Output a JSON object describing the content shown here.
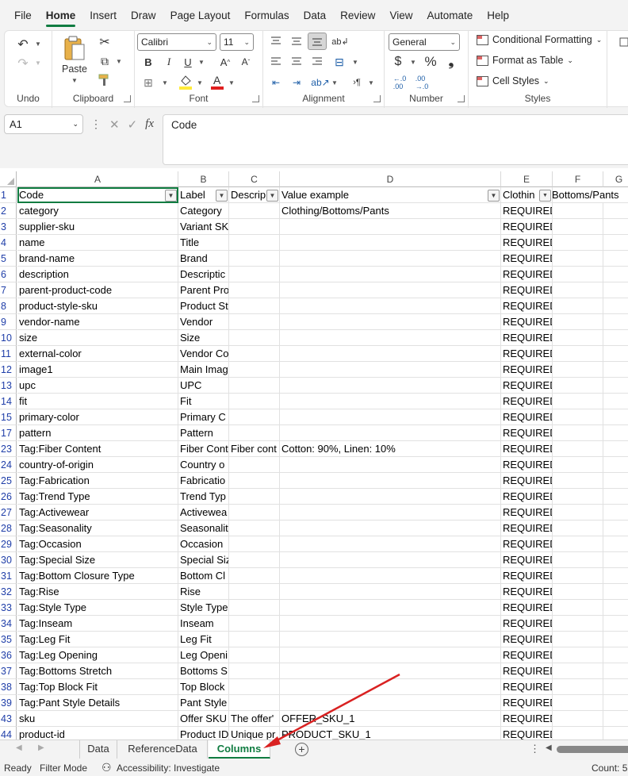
{
  "menu": [
    "File",
    "Home",
    "Insert",
    "Draw",
    "Page Layout",
    "Formulas",
    "Data",
    "Review",
    "View",
    "Automate",
    "Help"
  ],
  "menu_active": "Home",
  "ribbon": {
    "undo_label": "Undo",
    "clipboard_label": "Clipboard",
    "paste_label": "Paste",
    "font_label": "Font",
    "font_name": "Calibri",
    "font_size": "11",
    "alignment_label": "Alignment",
    "number_label": "Number",
    "number_format": "General",
    "styles_label": "Styles",
    "conditional_formatting": "Conditional Formatting",
    "format_as_table": "Format as Table",
    "cell_styles": "Cell Styles"
  },
  "formula_bar": {
    "name_box": "A1",
    "fx": "fx",
    "content": "Code"
  },
  "columns": [
    "A",
    "B",
    "C",
    "D",
    "E",
    "F"
  ],
  "rows": [
    {
      "n": "1",
      "a": "Code",
      "b": "Label",
      "c": "Descrip",
      "d": "Value example",
      "e": "Clothin",
      "f": "Bottoms/Pants"
    },
    {
      "n": "2",
      "a": "category",
      "b": "Category",
      "c": "",
      "d": "Clothing/Bottoms/Pants",
      "e": "REQUIRED",
      "f": ""
    },
    {
      "n": "3",
      "a": "supplier-sku",
      "b": "Variant SK",
      "c": "",
      "d": "",
      "e": "REQUIRED",
      "f": ""
    },
    {
      "n": "4",
      "a": "name",
      "b": "Title",
      "c": "",
      "d": "",
      "e": "REQUIRED",
      "f": ""
    },
    {
      "n": "5",
      "a": "brand-name",
      "b": "Brand",
      "c": "",
      "d": "",
      "e": "REQUIRED",
      "f": ""
    },
    {
      "n": "6",
      "a": "description",
      "b": "Descriptic",
      "c": "",
      "d": "",
      "e": "REQUIRED",
      "f": ""
    },
    {
      "n": "7",
      "a": "parent-product-code",
      "b": "Parent Pro",
      "c": "",
      "d": "",
      "e": "REQUIRED",
      "f": ""
    },
    {
      "n": "8",
      "a": "product-style-sku",
      "b": "Product St",
      "c": "",
      "d": "",
      "e": "REQUIRED",
      "f": ""
    },
    {
      "n": "9",
      "a": "vendor-name",
      "b": "Vendor",
      "c": "",
      "d": "",
      "e": "REQUIRED",
      "f": ""
    },
    {
      "n": "10",
      "a": "size",
      "b": "Size",
      "c": "",
      "d": "",
      "e": "REQUIRED",
      "f": ""
    },
    {
      "n": "11",
      "a": "external-color",
      "b": "Vendor Co",
      "c": "",
      "d": "",
      "e": "REQUIRED",
      "f": ""
    },
    {
      "n": "12",
      "a": "image1",
      "b": "Main Imag",
      "c": "",
      "d": "",
      "e": "REQUIRED",
      "f": ""
    },
    {
      "n": "13",
      "a": "upc",
      "b": "UPC",
      "c": "",
      "d": "",
      "e": "REQUIRED",
      "f": ""
    },
    {
      "n": "14",
      "a": "fit",
      "b": "Fit",
      "c": "",
      "d": "",
      "e": "REQUIRED",
      "f": ""
    },
    {
      "n": "15",
      "a": "primary-color",
      "b": "Primary C",
      "c": "",
      "d": "",
      "e": "REQUIRED",
      "f": ""
    },
    {
      "n": "17",
      "a": "pattern",
      "b": "Pattern",
      "c": "",
      "d": "",
      "e": "REQUIRED",
      "f": ""
    },
    {
      "n": "23",
      "a": "Tag:Fiber Content",
      "b": "Fiber Cont",
      "c": "Fiber cont",
      "d": "Cotton: 90%, Linen: 10%",
      "e": "REQUIRED",
      "f": ""
    },
    {
      "n": "24",
      "a": "country-of-origin",
      "b": "Country o",
      "c": "",
      "d": "",
      "e": "REQUIRED",
      "f": ""
    },
    {
      "n": "25",
      "a": "Tag:Fabrication",
      "b": "Fabricatio",
      "c": "",
      "d": "",
      "e": "REQUIRED",
      "f": ""
    },
    {
      "n": "26",
      "a": "Tag:Trend Type",
      "b": "Trend Typ",
      "c": "",
      "d": "",
      "e": "REQUIRED",
      "f": ""
    },
    {
      "n": "27",
      "a": "Tag:Activewear",
      "b": "Activewea",
      "c": "",
      "d": "",
      "e": "REQUIRED",
      "f": ""
    },
    {
      "n": "28",
      "a": "Tag:Seasonality",
      "b": "Seasonalit",
      "c": "",
      "d": "",
      "e": "REQUIRED",
      "f": ""
    },
    {
      "n": "29",
      "a": "Tag:Occasion",
      "b": "Occasion",
      "c": "",
      "d": "",
      "e": "REQUIRED",
      "f": ""
    },
    {
      "n": "30",
      "a": "Tag:Special Size",
      "b": "Special Siz",
      "c": "",
      "d": "",
      "e": "REQUIRED",
      "f": ""
    },
    {
      "n": "31",
      "a": "Tag:Bottom Closure Type",
      "b": "Bottom Cl",
      "c": "",
      "d": "",
      "e": "REQUIRED",
      "f": ""
    },
    {
      "n": "32",
      "a": "Tag:Rise",
      "b": "Rise",
      "c": "",
      "d": "",
      "e": "REQUIRED",
      "f": ""
    },
    {
      "n": "33",
      "a": "Tag:Style Type",
      "b": "Style Type",
      "c": "",
      "d": "",
      "e": "REQUIRED",
      "f": ""
    },
    {
      "n": "34",
      "a": "Tag:Inseam",
      "b": "Inseam",
      "c": "",
      "d": "",
      "e": "REQUIRED",
      "f": ""
    },
    {
      "n": "35",
      "a": "Tag:Leg Fit",
      "b": "Leg Fit",
      "c": "",
      "d": "",
      "e": "REQUIRED",
      "f": ""
    },
    {
      "n": "36",
      "a": "Tag:Leg Opening",
      "b": "Leg Openi",
      "c": "",
      "d": "",
      "e": "REQUIRED",
      "f": ""
    },
    {
      "n": "37",
      "a": "Tag:Bottoms Stretch",
      "b": "Bottoms S",
      "c": "",
      "d": "",
      "e": "REQUIRED",
      "f": ""
    },
    {
      "n": "38",
      "a": "Tag:Top Block Fit",
      "b": "Top Block",
      "c": "",
      "d": "",
      "e": "REQUIRED",
      "f": ""
    },
    {
      "n": "39",
      "a": "Tag:Pant Style Details",
      "b": "Pant Style",
      "c": "",
      "d": "",
      "e": "REQUIRED",
      "f": ""
    },
    {
      "n": "43",
      "a": "sku",
      "b": "Offer SKU",
      "c": "The offer'",
      "d": "OFFER_SKU_1",
      "e": "REQUIRED",
      "f": ""
    },
    {
      "n": "44",
      "a": "product-id",
      "b": "Product ID",
      "c": "Unique pr",
      "d": "PRODUCT_SKU_1",
      "e": "REQUIRED",
      "f": ""
    }
  ],
  "sheet_tabs": [
    "Data",
    "ReferenceData",
    "Columns"
  ],
  "active_tab": "Columns",
  "status": {
    "ready": "Ready",
    "filter_mode": "Filter Mode",
    "accessibility": "Accessibility: Investigate",
    "count": "Count: 5"
  },
  "colors": {
    "accent": "#107c41",
    "row_number": "#1f3ea8",
    "annotation_arrow": "#d92121"
  }
}
